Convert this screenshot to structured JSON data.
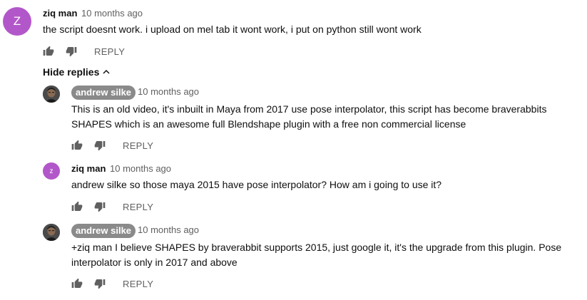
{
  "colors": {
    "avatar_ziq": "#b257c9",
    "badge_bg": "#8a8a8a",
    "meta_text": "#606060"
  },
  "comment": {
    "avatar_letter": "Z",
    "author": "ziq man",
    "time": "10 months ago",
    "text": "the script doesnt work. i upload on mel tab it wont work, i put on python still wont work",
    "reply_label": "REPLY"
  },
  "hide_replies_label": "Hide replies",
  "replies": [
    {
      "author": "andrew silke",
      "time": "10 months ago",
      "text": "This is an old video, it's inbuilt in Maya from 2017 use pose interpolator, this script has become braverabbits SHAPES which is an awesome full Blendshape plugin with a free non commercial license",
      "reply_label": "REPLY"
    },
    {
      "avatar_letter": "z",
      "author": "ziq man",
      "time": "10 months ago",
      "text": "andrew silke so those maya 2015 have pose interpolator? How am i going to use it?",
      "reply_label": "REPLY"
    },
    {
      "author": "andrew silke",
      "time": "10 months ago",
      "text": "+ziq man I believe SHAPES by braverabbit supports 2015, just google it, it's the upgrade from this plugin. Pose interpolator is only in 2017 and above",
      "reply_label": "REPLY"
    }
  ]
}
